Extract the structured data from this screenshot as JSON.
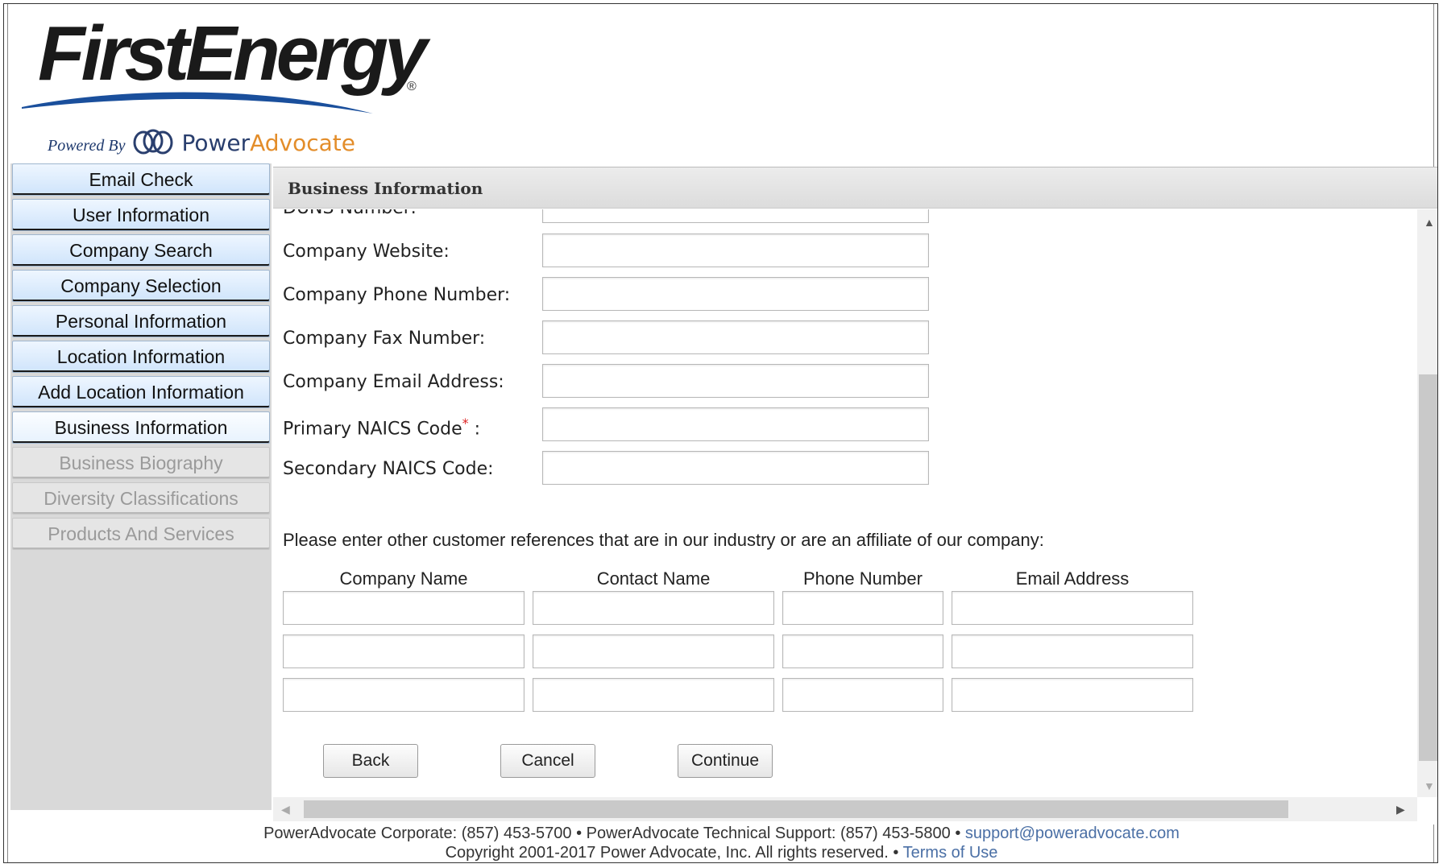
{
  "brand": {
    "logo_text": "FirstEnergy",
    "powered_by": "Powered By",
    "power_word": "Power",
    "advocate_word": "Advocate"
  },
  "sidebar": {
    "items": [
      {
        "label": "Email Check",
        "state": "enabled"
      },
      {
        "label": "User Information",
        "state": "enabled"
      },
      {
        "label": "Company Search",
        "state": "enabled"
      },
      {
        "label": "Company Selection",
        "state": "enabled"
      },
      {
        "label": "Personal Information",
        "state": "enabled"
      },
      {
        "label": "Location Information",
        "state": "enabled"
      },
      {
        "label": "Add Location Information",
        "state": "enabled"
      },
      {
        "label": "Business Information",
        "state": "active"
      },
      {
        "label": "Business Biography",
        "state": "disabled"
      },
      {
        "label": "Diversity Classifications",
        "state": "disabled"
      },
      {
        "label": "Products And Services",
        "state": "disabled"
      }
    ]
  },
  "panel": {
    "title": "Business Information",
    "fields": [
      {
        "label": "DUNS Number:",
        "value": ""
      },
      {
        "label": "Company Website:",
        "value": ""
      },
      {
        "label": "Company Phone Number:",
        "value": ""
      },
      {
        "label": "Company Fax Number:",
        "value": ""
      },
      {
        "label": "Company Email Address:",
        "value": ""
      },
      {
        "label": "Primary NAICS Code",
        "required_mark": "*",
        "suffix": " :",
        "value": ""
      },
      {
        "label": "Secondary NAICS Code:",
        "value": ""
      }
    ],
    "references": {
      "instruction": "Please enter other customer references that are in our industry or are an affiliate of our company:",
      "columns": [
        "Company Name",
        "Contact Name",
        "Phone Number",
        "Email Address"
      ],
      "rows": [
        [
          "",
          "",
          "",
          ""
        ],
        [
          "",
          "",
          "",
          ""
        ],
        [
          "",
          "",
          "",
          ""
        ]
      ]
    },
    "buttons": {
      "back": "Back",
      "cancel": "Cancel",
      "continue": "Continue"
    }
  },
  "footer": {
    "line1": "PowerAdvocate Corporate: (857) 453-5700 • PowerAdvocate Technical Support: (857) 453-5800 • ",
    "support_email": "support@poweradvocate.com",
    "line2": "Copyright 2001-2017 Power Advocate, Inc. All rights reserved. • ",
    "terms_link": "Terms of Use"
  },
  "colors": {
    "nav_active_bg": "#cfe4fb",
    "disabled_text": "#9a9a9a",
    "required_mark": "#dd2222",
    "link": "#4a6fa5",
    "advocate_orange": "#e38d2a"
  }
}
